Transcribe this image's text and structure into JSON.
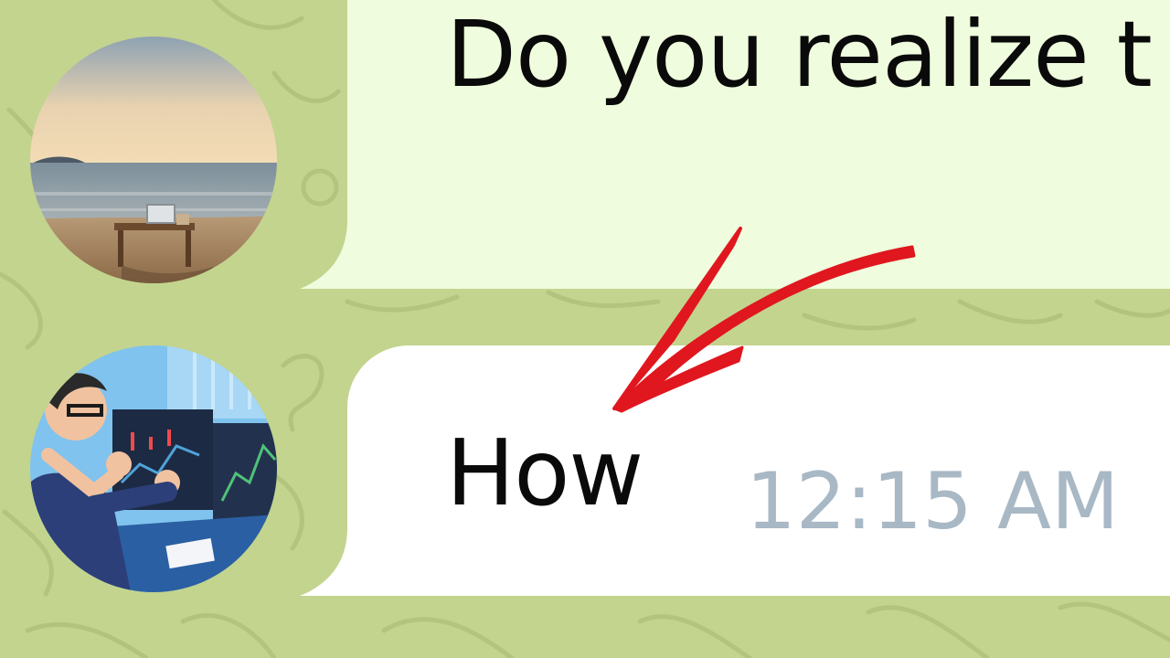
{
  "chat": {
    "messages": [
      {
        "direction": "outgoing",
        "text": "Do you realize t",
        "bubble_color": "#effdde",
        "avatar_icon": "beach-desk-avatar"
      },
      {
        "direction": "incoming",
        "text": "How",
        "time": "12:15 AM",
        "bubble_color": "#ffffff",
        "avatar_icon": "trader-avatar"
      }
    ]
  },
  "annotation": {
    "arrow_color": "#e0171f",
    "icon": "red-arrow-annotation"
  },
  "theme": {
    "background": "#c3d48e",
    "time_color": "#a8b8c5"
  }
}
